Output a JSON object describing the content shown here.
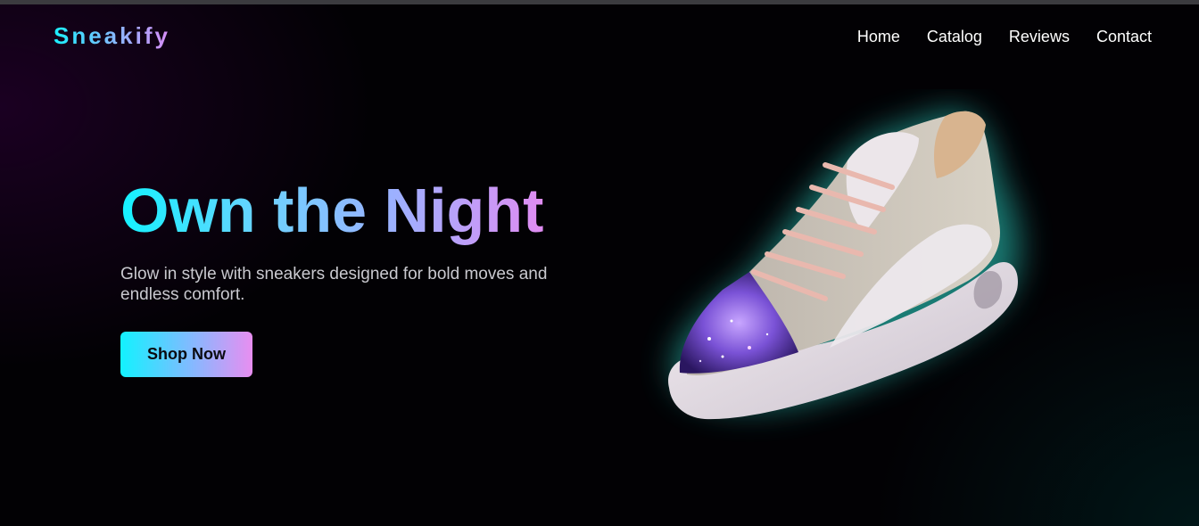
{
  "brand": {
    "logo": "Sneakify"
  },
  "nav": {
    "items": [
      {
        "label": "Home"
      },
      {
        "label": "Catalog"
      },
      {
        "label": "Reviews"
      },
      {
        "label": "Contact"
      }
    ]
  },
  "hero": {
    "title": "Own the Night",
    "subtitle": "Glow in style with sneakers designed for bold moves and endless comfort.",
    "cta_label": "Shop Now",
    "image": "glowing-sneaker-image"
  },
  "colors": {
    "background": "#020104",
    "accent_cyan": "#14f2ff",
    "accent_pink": "#e08cf2",
    "nav_text": "#ffffff",
    "subtitle_text": "#c9c9cf",
    "glow": "#2de0d0"
  }
}
